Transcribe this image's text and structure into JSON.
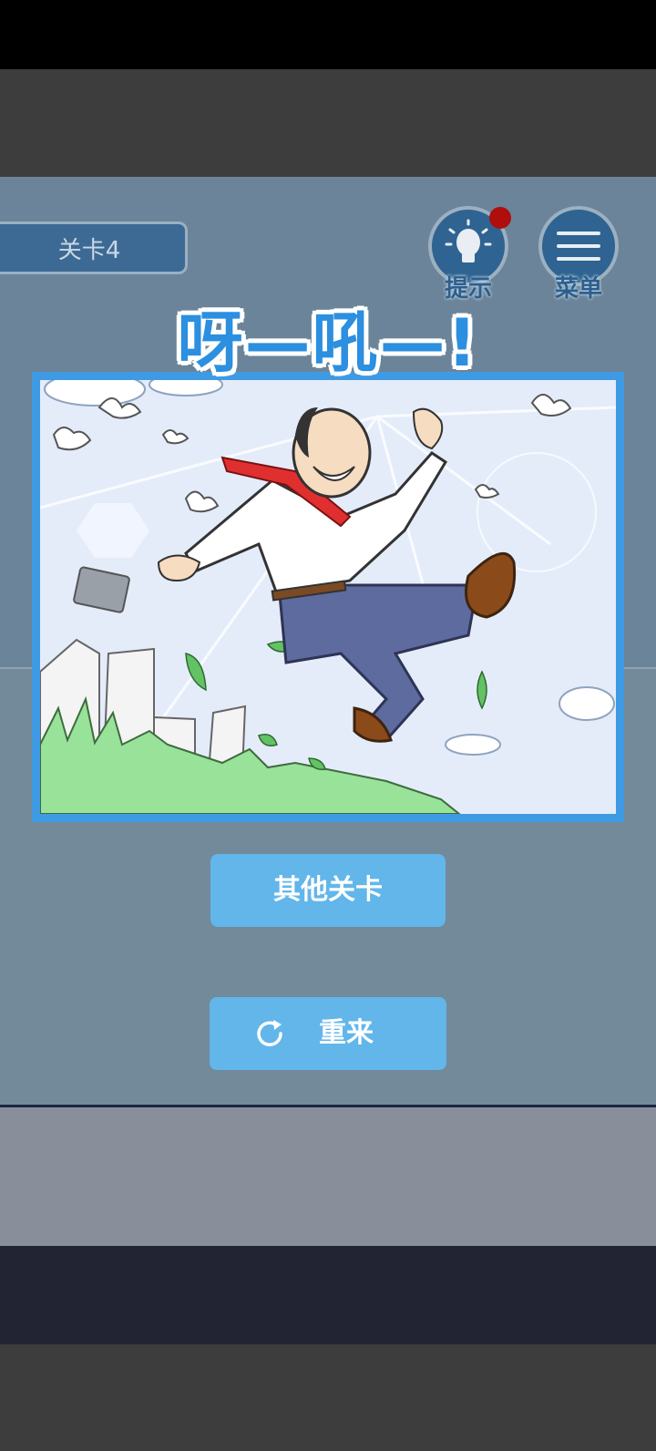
{
  "level": {
    "label": "关卡4"
  },
  "hint": {
    "label": "提示",
    "icon": "lightbulb-icon",
    "has_notification": true
  },
  "menu": {
    "label": "菜单",
    "icon": "hamburger-menu-icon"
  },
  "banner": {
    "title": "呀—吼—!"
  },
  "scene": {
    "description_icon": "jumping-salaryman-illustration"
  },
  "buttons": {
    "other_levels": "其他关卡",
    "retry": "重来",
    "retry_icon": "refresh-icon"
  },
  "colors": {
    "accent": "#62b6ea",
    "frame": "#3f9ae4",
    "background": "#6b8499",
    "notification": "#b00d0d"
  }
}
